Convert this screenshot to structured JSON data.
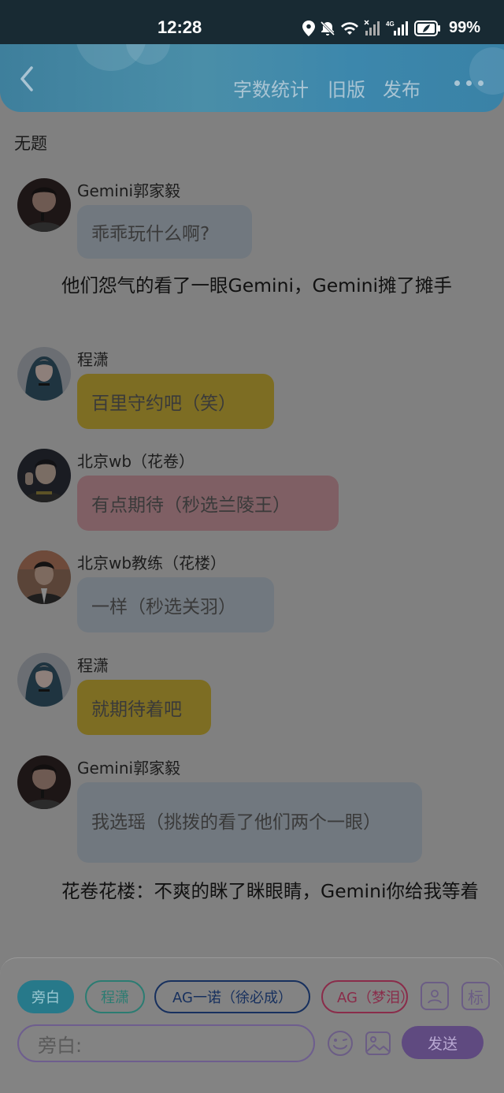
{
  "status_bar": {
    "time": "12:28",
    "battery": "99%",
    "network": "4G"
  },
  "header": {
    "actions": [
      "字数统计",
      "旧版",
      "发布"
    ]
  },
  "story": {
    "title": "无题",
    "items": [
      {
        "type": "message",
        "name": "Gemini郭家毅",
        "text": "乖乖玩什么啊?",
        "color": "gray"
      },
      {
        "type": "narration",
        "text": "他们怨气的看了一眼Gemini，Gemini摊了摊手"
      },
      {
        "type": "message",
        "name": "程潇",
        "text": "百里守约吧（笑）",
        "color": "yellow"
      },
      {
        "type": "message",
        "name": "北京wb（花卷）",
        "text": "有点期待（秒选兰陵王）",
        "color": "pink"
      },
      {
        "type": "message",
        "name": "北京wb教练（花楼）",
        "text": "一样（秒选关羽）",
        "color": "gray"
      },
      {
        "type": "message",
        "name": "程潇",
        "text": "就期待着吧",
        "color": "yellow"
      },
      {
        "type": "message",
        "name": "Gemini郭家毅",
        "text": "我选瑶（挑拨的看了他们两个一眼）",
        "color": "gray"
      },
      {
        "type": "narration",
        "text": "花卷花楼：不爽的眯了眯眼睛，Gemini你给我等着"
      }
    ]
  },
  "composer": {
    "chips": [
      "旁白",
      "程潇",
      "AG一诺（徐必成）",
      "AG（梦泪）"
    ],
    "square_icon_2": "标",
    "placeholder": "旁白:",
    "send_label": "发送"
  },
  "colors": {
    "bubble_gray": "#71787f",
    "bubble_yellow": "#7d6d23",
    "bubble_pink": "#7f5f64",
    "accent_purple": "#5f4a80"
  }
}
